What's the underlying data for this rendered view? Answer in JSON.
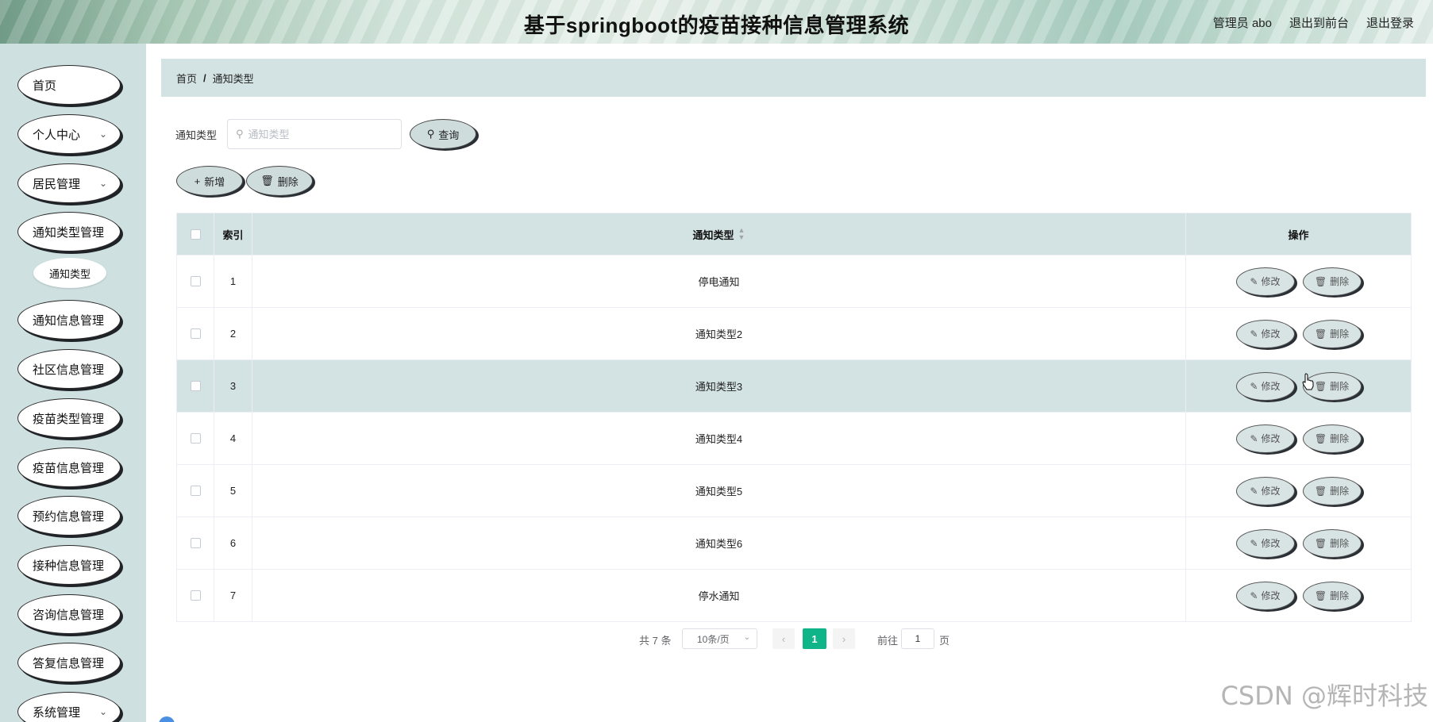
{
  "header": {
    "title": "基于springboot的疫苗接种信息管理系统",
    "role": "管理员",
    "username": "abo",
    "back_to_front": "退出到前台",
    "logout": "退出登录"
  },
  "sidebar": {
    "items": [
      {
        "label": "首页",
        "has_children": false
      },
      {
        "label": "个人中心",
        "has_children": true
      },
      {
        "label": "居民管理",
        "has_children": true
      },
      {
        "label": "通知类型管理",
        "has_children": false
      },
      {
        "label": "通知信息管理",
        "has_children": false
      },
      {
        "label": "社区信息管理",
        "has_children": false
      },
      {
        "label": "疫苗类型管理",
        "has_children": false
      },
      {
        "label": "疫苗信息管理",
        "has_children": false
      },
      {
        "label": "预约信息管理",
        "has_children": false
      },
      {
        "label": "接种信息管理",
        "has_children": false
      },
      {
        "label": "咨询信息管理",
        "has_children": false
      },
      {
        "label": "答复信息管理",
        "has_children": false
      },
      {
        "label": "系统管理",
        "has_children": true
      }
    ],
    "submenu": {
      "label": "通知类型"
    }
  },
  "breadcrumb": {
    "home": "首页",
    "separator": "/",
    "current": "通知类型"
  },
  "search": {
    "label": "通知类型",
    "placeholder": "通知类型",
    "value": "",
    "button": "查询"
  },
  "actions": {
    "add": "新增",
    "delete": "删除"
  },
  "table": {
    "columns": {
      "index": "索引",
      "type": "通知类型",
      "operation": "操作"
    },
    "rows": [
      {
        "index": "1",
        "type": "停电通知"
      },
      {
        "index": "2",
        "type": "通知类型2"
      },
      {
        "index": "3",
        "type": "通知类型3"
      },
      {
        "index": "4",
        "type": "通知类型4"
      },
      {
        "index": "5",
        "type": "通知类型5"
      },
      {
        "index": "6",
        "type": "通知类型6"
      },
      {
        "index": "7",
        "type": "停水通知"
      }
    ],
    "edit_label": "修改",
    "delete_label": "删除",
    "highlighted_row": 2
  },
  "pagination": {
    "total": "共 7 条",
    "page_size": "10条/页",
    "current_page": "1",
    "goto_label": "前往",
    "goto_value": "1",
    "page_unit": "页"
  },
  "watermark": "CSDN @辉时科技",
  "colors": {
    "accent": "#0fb488",
    "header_bg": "#d3e2e3",
    "sidebar_bg": "#cfe0e1"
  }
}
